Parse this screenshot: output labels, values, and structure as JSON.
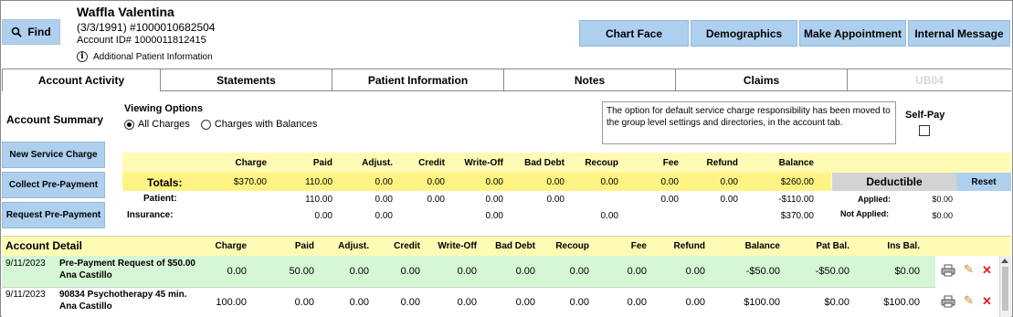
{
  "header": {
    "find_label": "Find",
    "patient_name": "Waffla Valentina",
    "dob_line": "(3/3/1991) #1000010682504",
    "account_line": "Account ID# 1000011812415",
    "additional_info": "Additional Patient Information",
    "buttons": [
      "Chart Face",
      "Demographics",
      "Make Appointment",
      "Internal Message"
    ]
  },
  "tabs": [
    {
      "label": "Account Activity",
      "active": true
    },
    {
      "label": "Statements"
    },
    {
      "label": "Patient Information"
    },
    {
      "label": "Notes"
    },
    {
      "label": "Claims"
    },
    {
      "label": "UB04",
      "disabled": true
    }
  ],
  "summary": {
    "title": "Account Summary",
    "viewing_title": "Viewing Options",
    "opt_all": "All Charges",
    "opt_bal": "Charges with Balances",
    "notice": "The option for default service charge responsibility has been moved to the group level settings and directories, in the account tab.",
    "self_pay": "Self-Pay"
  },
  "side_buttons": [
    "New Service Charge",
    "Collect Pre-Payment",
    "Request Pre-Payment"
  ],
  "grid": {
    "headers": [
      "Charge",
      "Paid",
      "Adjust.",
      "Credit",
      "Write-Off",
      "Bad Debt",
      "Recoup",
      "Fee",
      "Refund",
      "Balance"
    ],
    "totals_label": "Totals:",
    "totals": [
      "$370.00",
      "110.00",
      "0.00",
      "0.00",
      "0.00",
      "0.00",
      "0.00",
      "0.00",
      "0.00",
      "$260.00"
    ],
    "patient_label": "Patient:",
    "patient": [
      "",
      "110.00",
      "0.00",
      "0.00",
      "0.00",
      "0.00",
      "",
      "0.00",
      "0.00",
      "-$110.00"
    ],
    "insurance_label": "Insurance:",
    "insurance": [
      "",
      "0.00",
      "0.00",
      "",
      "0.00",
      "",
      "0.00",
      "",
      "",
      "$370.00"
    ],
    "deductible": "Deductible",
    "reset": "Reset",
    "applied_label": "Applied:",
    "applied": "$0.00",
    "not_applied_label": "Not Applied:",
    "not_applied": "$0.00"
  },
  "detail": {
    "title": "Account Detail",
    "headers": [
      "Charge",
      "Paid",
      "Adjust.",
      "Credit",
      "Write-Off",
      "Bad Debt",
      "Recoup",
      "Fee",
      "Refund",
      "Balance",
      "Pat Bal.",
      "Ins Bal."
    ],
    "rows": [
      {
        "date": "9/11/2023",
        "desc": "Pre-Payment Request of $50.00",
        "provider": "Ana Castillo",
        "values": [
          "0.00",
          "50.00",
          "0.00",
          "0.00",
          "0.00",
          "0.00",
          "0.00",
          "0.00",
          "0.00",
          "-$50.00",
          "-$50.00",
          "$0.00"
        ]
      },
      {
        "date": "9/11/2023",
        "desc": "90834 Psychotherapy 45 min.",
        "provider": "Ana Castillo",
        "values": [
          "100.00",
          "0.00",
          "0.00",
          "0.00",
          "0.00",
          "0.00",
          "0.00",
          "0.00",
          "0.00",
          "$100.00",
          "$0.00",
          "$100.00"
        ]
      }
    ]
  },
  "icons": {
    "find": "magnifier-icon",
    "info": "info-icon",
    "print": "printer-icon",
    "edit": "pencil-icon",
    "delete": "x-icon"
  }
}
